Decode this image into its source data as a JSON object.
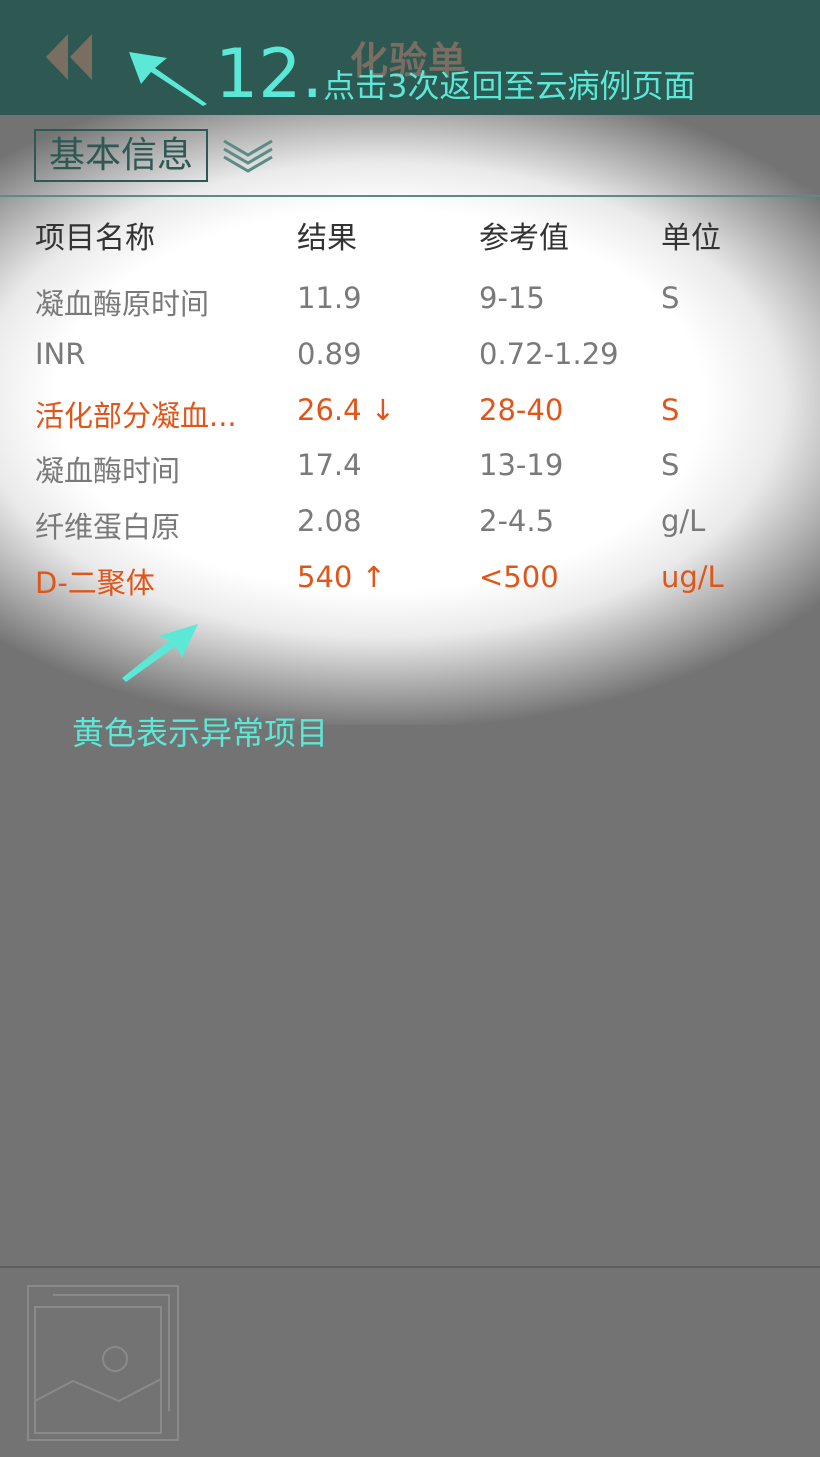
{
  "header": {
    "title": "化验单",
    "back_icon": "double-chevron-left-icon",
    "accent_color": "#2e5953"
  },
  "section": {
    "label": "基本信息",
    "expand_icon": "double-chevron-down-icon"
  },
  "table": {
    "columns": [
      "项目名称",
      "结果",
      "参考值",
      "单位"
    ],
    "rows": [
      {
        "name": "凝血酶原时间",
        "result": "11.9",
        "reference": "9-15",
        "unit": "S",
        "abnormal": false
      },
      {
        "name": "INR",
        "result": "0.89",
        "reference": "0.72-1.29",
        "unit": "",
        "abnormal": false
      },
      {
        "name": "活化部分凝血...",
        "result": "26.4 ↓",
        "reference": "28-40",
        "unit": "S",
        "abnormal": true
      },
      {
        "name": "凝血酶时间",
        "result": "17.4",
        "reference": "13-19",
        "unit": "S",
        "abnormal": false
      },
      {
        "name": "纤维蛋白原",
        "result": "2.08",
        "reference": "2-4.5",
        "unit": "g/L",
        "abnormal": false
      },
      {
        "name": "D-二聚体",
        "result": "540 ↑",
        "reference": "<500",
        "unit": "ug/L",
        "abnormal": true
      }
    ],
    "abnormal_color": "#e0561a"
  },
  "annotations": {
    "step_number": "12.",
    "step_text": "点击3次返回至云病例页面",
    "legend_text": "黄色表示异常项目",
    "color": "#5ce8d6"
  },
  "footer": {
    "thumbnail_icon": "image-placeholder-icon"
  }
}
